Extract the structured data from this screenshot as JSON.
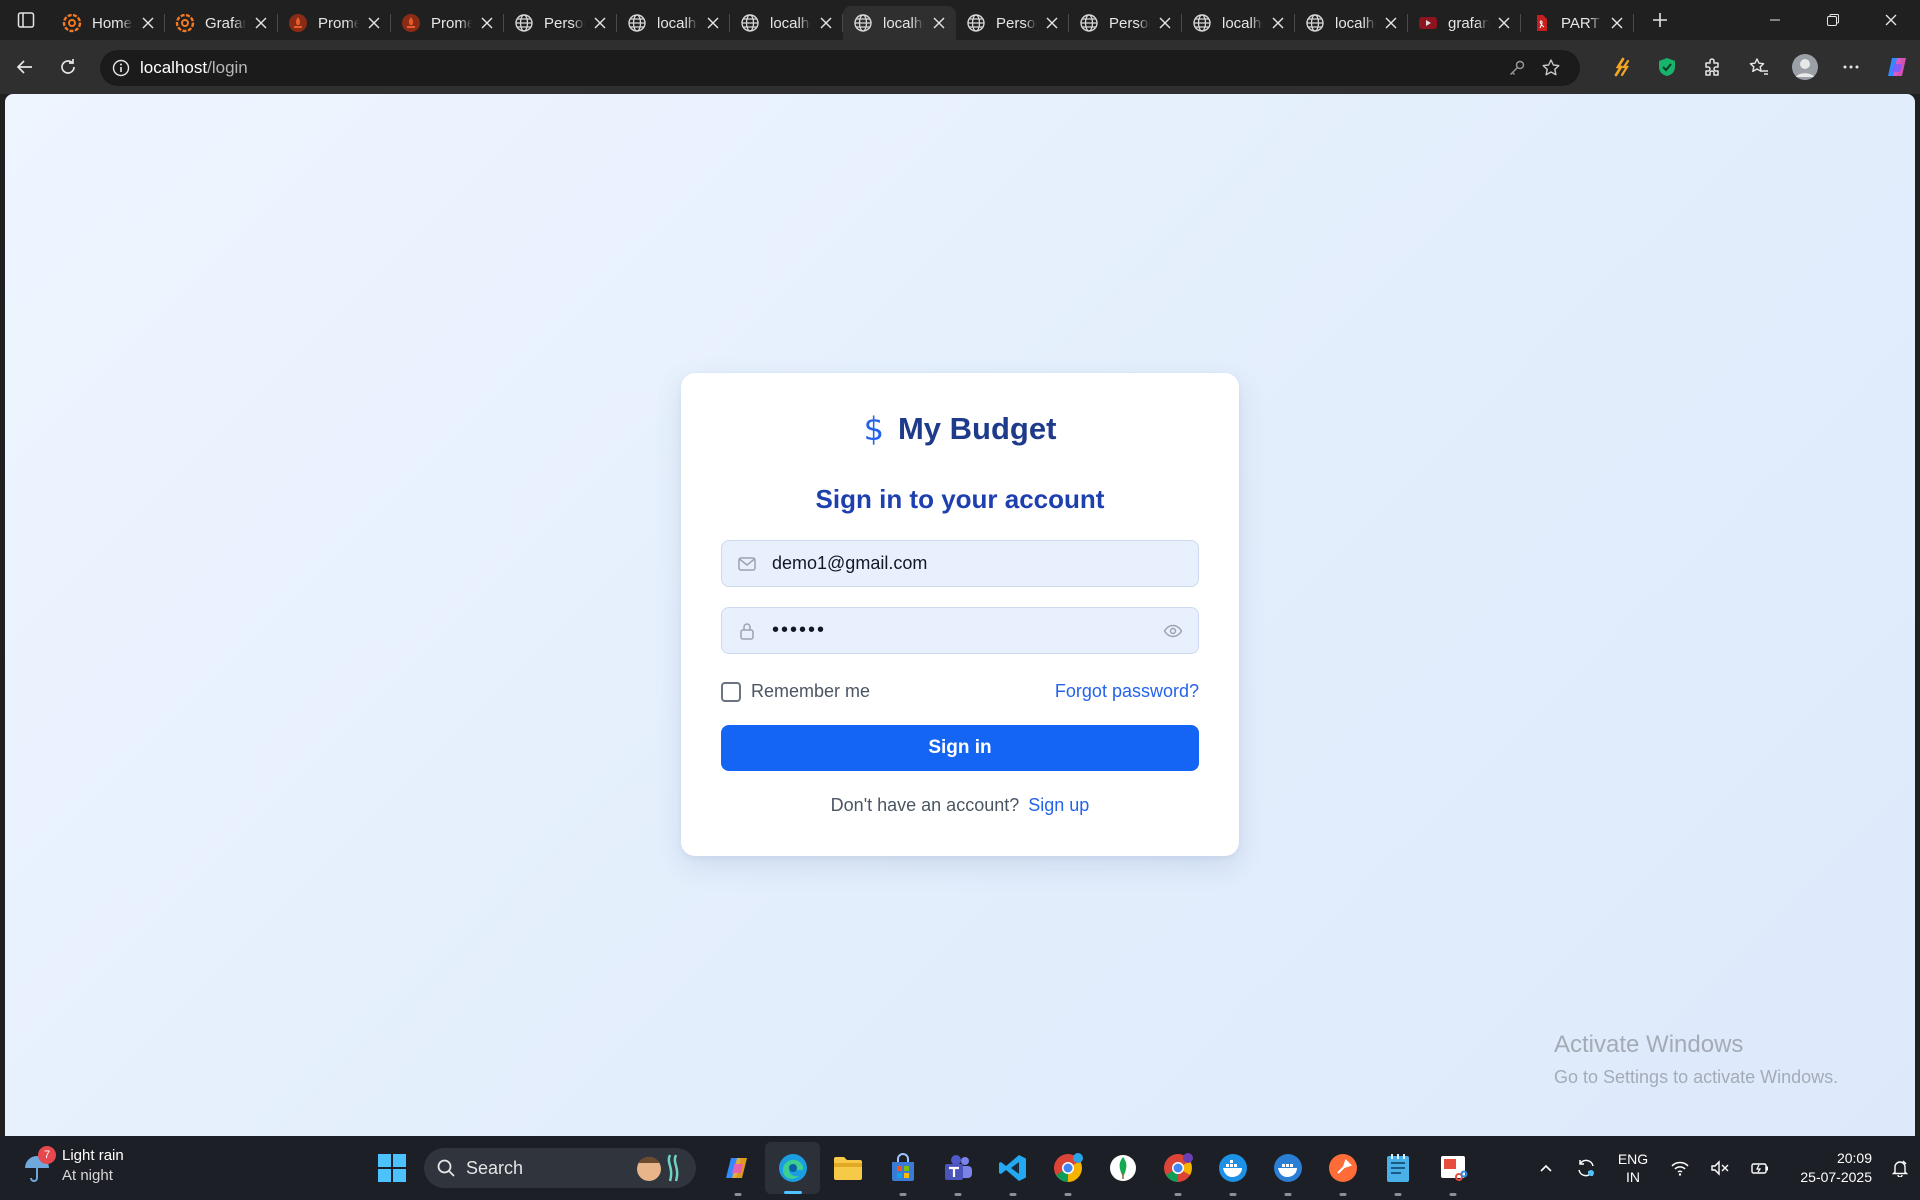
{
  "browser": {
    "tabs": [
      {
        "label": "Home",
        "icon": "grafana-icon"
      },
      {
        "label": "Grafana",
        "icon": "grafana-icon"
      },
      {
        "label": "Prometheus",
        "icon": "prometheus-icon"
      },
      {
        "label": "Prometheus",
        "icon": "prometheus-icon"
      },
      {
        "label": "Personal",
        "icon": "globe-icon"
      },
      {
        "label": "localhost",
        "icon": "globe-icon"
      },
      {
        "label": "localhost",
        "icon": "globe-icon"
      },
      {
        "label": "localhost",
        "icon": "globe-icon",
        "active": true
      },
      {
        "label": "Personal",
        "icon": "globe-icon"
      },
      {
        "label": "Personal",
        "icon": "globe-icon"
      },
      {
        "label": "localhost",
        "icon": "globe-icon"
      },
      {
        "label": "localhost",
        "icon": "globe-icon"
      },
      {
        "label": "grafana",
        "icon": "youtube-icon"
      },
      {
        "label": "PART",
        "icon": "pdf-icon"
      }
    ],
    "address": {
      "host": "localhost",
      "path": "/login"
    }
  },
  "login": {
    "brand": "My Budget",
    "brand_icon": "dollar-icon",
    "subtitle": "Sign in to your account",
    "email_value": "demo1@gmail.com",
    "password_value": "••••••",
    "remember_label": "Remember me",
    "forgot_label": "Forgot password?",
    "signin_label": "Sign in",
    "signup_prompt": "Don't have an account?",
    "signup_label": "Sign up"
  },
  "watermark": {
    "line1": "Activate Windows",
    "line2": "Go to Settings to activate Windows."
  },
  "taskbar": {
    "weather": {
      "temp": "7",
      "condition": "Light rain",
      "sub": "At night"
    },
    "search_label": "Search",
    "lang": {
      "line1": "ENG",
      "line2": "IN"
    },
    "time": "20:09",
    "date": "25-07-2025"
  },
  "colors": {
    "accent": "#1565f5",
    "brand": "#1e3a8a",
    "subtitle": "#1e40af",
    "link": "#2563eb"
  }
}
